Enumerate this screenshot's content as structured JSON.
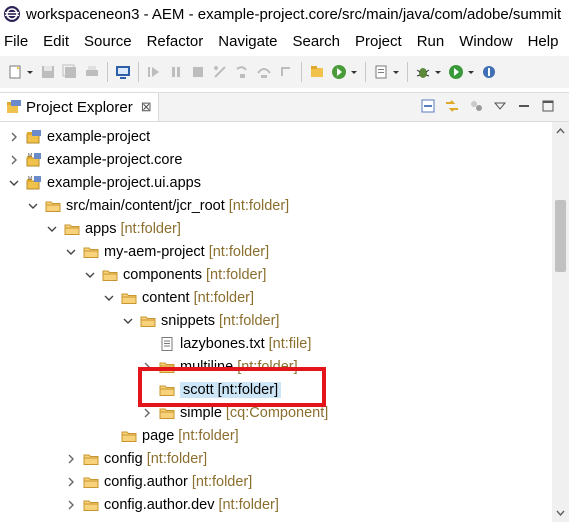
{
  "window": {
    "title": "workspaceneon3 - AEM - example-project.core/src/main/java/com/adobe/summit"
  },
  "menu": {
    "items": [
      "File",
      "Edit",
      "Source",
      "Refactor",
      "Navigate",
      "Search",
      "Project",
      "Run",
      "Window",
      "Help"
    ]
  },
  "project_explorer": {
    "tab_label": "Project Explorer",
    "close_label": "⊠",
    "tree": [
      {
        "label": "example-project",
        "deco": "",
        "expanded": false,
        "icon": "project-icon"
      },
      {
        "label": "example-project.core",
        "deco": "",
        "expanded": false,
        "icon": "maven-project-icon"
      },
      {
        "label": "example-project.ui.apps",
        "deco": "",
        "expanded": true,
        "icon": "maven-project-icon"
      },
      {
        "label": "src/main/content/jcr_root",
        "deco": "[nt:folder]",
        "expanded": true,
        "icon": "folder-icon"
      },
      {
        "label": "apps",
        "deco": "[nt:folder]",
        "expanded": true,
        "icon": "folder-icon"
      },
      {
        "label": "my-aem-project",
        "deco": "[nt:folder]",
        "expanded": true,
        "icon": "folder-icon"
      },
      {
        "label": "components",
        "deco": "[nt:folder]",
        "expanded": true,
        "icon": "folder-icon"
      },
      {
        "label": "content",
        "deco": "[nt:folder]",
        "expanded": true,
        "icon": "folder-icon"
      },
      {
        "label": "snippets",
        "deco": "[nt:folder]",
        "expanded": true,
        "icon": "folder-icon"
      },
      {
        "label": "lazybones.txt",
        "deco": "[nt:file]",
        "expanded": null,
        "icon": "file-icon"
      },
      {
        "label": "multiline",
        "deco": "[nt:folder]",
        "expanded": false,
        "icon": "folder-icon"
      },
      {
        "label": "scott [nt:folder]",
        "deco": "",
        "expanded": null,
        "icon": "folder-icon",
        "selected": true
      },
      {
        "label": "simple",
        "deco": "[cq:Component]",
        "expanded": false,
        "icon": "folder-icon"
      },
      {
        "label": "page",
        "deco": "[nt:folder]",
        "expanded": null,
        "icon": "folder-icon"
      },
      {
        "label": "config",
        "deco": "[nt:folder]",
        "expanded": false,
        "icon": "folder-icon"
      },
      {
        "label": "config.author",
        "deco": "[nt:folder]",
        "expanded": false,
        "icon": "folder-icon"
      },
      {
        "label": "config.author.dev",
        "deco": "[nt:folder]",
        "expanded": false,
        "icon": "folder-icon"
      }
    ]
  },
  "colors": {
    "annotation": "#e3151b",
    "selection": "#cde6f7",
    "decoration": "#8b6f2e",
    "folder": "#e8b54a"
  }
}
